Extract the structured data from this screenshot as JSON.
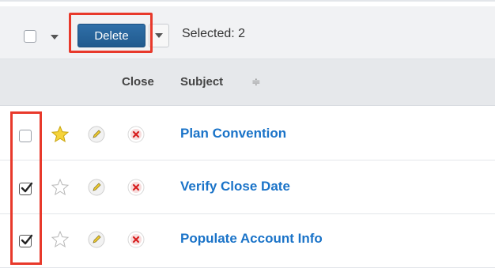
{
  "toolbar": {
    "delete_label": "Delete",
    "selected_text": "Selected: 2"
  },
  "table": {
    "columns": [
      "Close",
      "Subject"
    ],
    "rows": [
      {
        "subject": "Plan Convention",
        "selected": false,
        "favorite": true
      },
      {
        "subject": "Verify Close Date",
        "selected": true,
        "favorite": false
      },
      {
        "subject": "Populate Account Info",
        "selected": true,
        "favorite": false
      }
    ]
  },
  "colors": {
    "accent": "#215a8e",
    "link": "#1a73c8",
    "highlight": "#e8392b",
    "favorite": "#f5d33b"
  },
  "icons": [
    "checkbox",
    "chevron-down-icon",
    "star-icon",
    "pencil-icon",
    "close-icon",
    "sort-icon"
  ]
}
